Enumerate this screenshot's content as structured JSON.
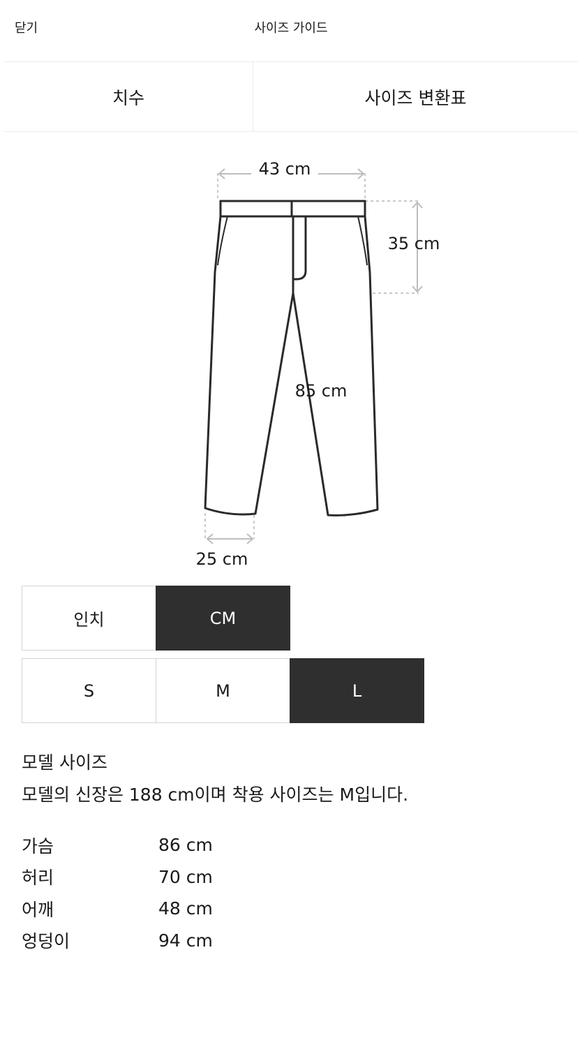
{
  "header": {
    "close_label": "닫기",
    "title": "사이즈 가이드"
  },
  "tabs": [
    {
      "label": "치수",
      "active": true
    },
    {
      "label": "사이즈 변환표",
      "active": false
    }
  ],
  "diagram": {
    "garment": "pants",
    "waist_label": "43 cm",
    "rise_label": "35 cm",
    "inseam_label": "85 cm",
    "hem_label": "25 cm"
  },
  "unit_toggle": {
    "options": [
      "인치",
      "CM"
    ],
    "selected": "CM"
  },
  "size_toggle": {
    "options": [
      "S",
      "M",
      "L"
    ],
    "selected": "L"
  },
  "model": {
    "heading": "모델 사이즈",
    "description": "모델의 신장은 188 cm이며 착용 사이즈는 M입니다.",
    "measurements": [
      {
        "label": "가슴",
        "value": "86 cm"
      },
      {
        "label": "허리",
        "value": "70 cm"
      },
      {
        "label": "어깨",
        "value": "48 cm"
      },
      {
        "label": "엉덩이",
        "value": "94 cm"
      }
    ]
  },
  "colors": {
    "active_bg": "#2f2f2f",
    "divider": "#ececec",
    "option_border": "#d4d4d4",
    "guide_line": "#c8c8c8"
  }
}
